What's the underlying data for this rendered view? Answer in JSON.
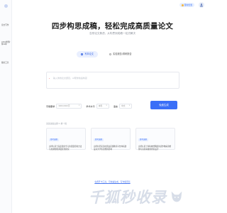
{
  "sidebar": {
    "items": [
      {
        "label": "论文写作"
      },
      {
        "label": "AIGC检测/降AI率"
      },
      {
        "label": "我的工具"
      }
    ]
  },
  "header": {
    "vip_label": "限时优惠",
    "avatar_icon": "user-icon"
  },
  "hero": {
    "title": "四步构思成稿，轻松完成高质量论文",
    "subtitle": "告别论文焦虑，从构思到成稿一站式解决"
  },
  "mode_tabs": [
    {
      "label": "写本论文",
      "active": true
    },
    {
      "label": "实验报告/调研报告",
      "active": false
    }
  ],
  "title_input": {
    "required_mark": "*",
    "placeholder": "输入你的论文题目，AI帮你快速构思"
  },
  "options": {
    "words": {
      "label": "字数要求",
      "value": "3000-6000字"
    },
    "level": {
      "label": "学术水平",
      "value": "本科"
    },
    "lang": {
      "label": "语言",
      "value": "中文"
    }
  },
  "generate_button": {
    "label": "免费生成"
  },
  "examples": {
    "label": "试试这些主题 ↻ 换一批",
    "cards": [
      {
        "badge": "参考选题",
        "text": "[示例] 基于深度强化学习的流量控制方法与交通智能调度优化研究"
      },
      {
        "badge": "参考选题",
        "text": "[示例] 研究高校思政实践教育平台体系建设对大学生思想的影响"
      },
      {
        "badge": "参考选题",
        "text": "[示例] 基于卷积神经网络的农作物病害检测与识别系统的研究设计"
      }
    ]
  },
  "bottom_link": "免费开卡工具，可快速生成、写作和预览",
  "watermark": {
    "text": "千狐秒收录",
    "icon": "fox-logo-icon"
  },
  "colors": {
    "accent": "#3a6ff7",
    "tab_active_bg": "#e9efff",
    "sidebar_bg": "#fafbfd"
  }
}
